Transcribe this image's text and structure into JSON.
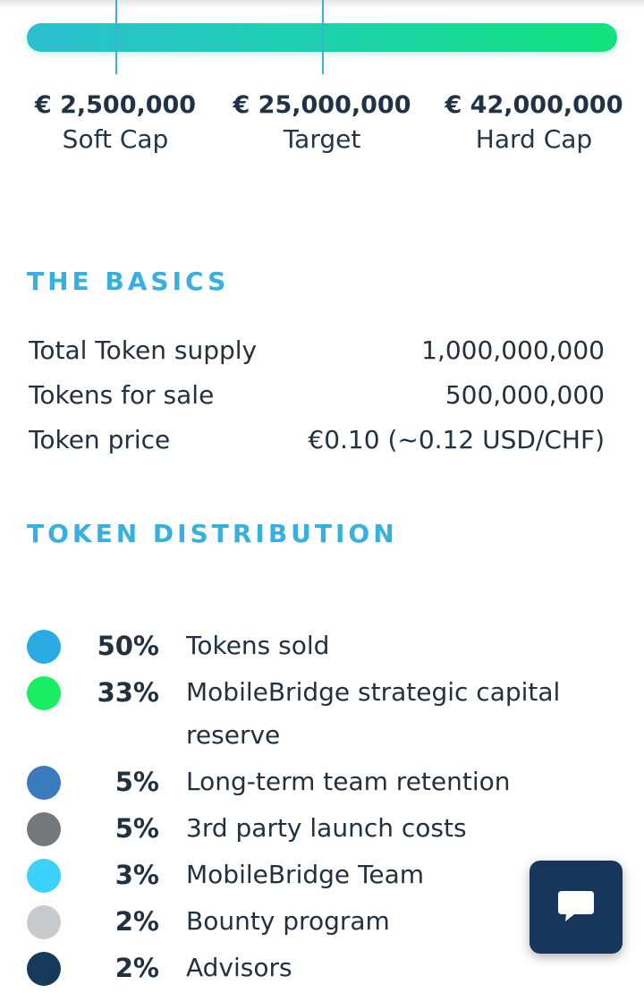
{
  "funding": {
    "soft_cap": {
      "amount": "€ 2,500,000",
      "label": "Soft Cap"
    },
    "target": {
      "amount": "€ 25,000,000",
      "label": "Target"
    },
    "hard_cap": {
      "amount": "€ 42,000,000",
      "label": "Hard Cap"
    },
    "bar_gradient": [
      "#2bbfcf",
      "#12e37e"
    ],
    "marker_color": "#3ab1d6"
  },
  "basics": {
    "heading": "THE BASICS",
    "rows": [
      {
        "label": "Total Token supply",
        "value": "1,000,000,000"
      },
      {
        "label": "Tokens for sale",
        "value": "500,000,000"
      },
      {
        "label": "Token price",
        "value": "€0.10 (~0.12 USD/CHF)"
      }
    ]
  },
  "distribution": {
    "heading": "TOKEN DISTRIBUTION",
    "items": [
      {
        "percent": "50%",
        "label": "Tokens sold",
        "color": "#2aabe4"
      },
      {
        "percent": "33%",
        "label": "MobileBridge strategic capital reserve",
        "color": "#19ee63"
      },
      {
        "percent": "5%",
        "label": "Long-term team retention",
        "color": "#3a7bbd"
      },
      {
        "percent": "5%",
        "label": "3rd party launch costs",
        "color": "#75787b"
      },
      {
        "percent": "3%",
        "label": "MobileBridge Team",
        "color": "#3bd2fb"
      },
      {
        "percent": "2%",
        "label": "Bounty program",
        "color": "#c7cbce"
      },
      {
        "percent": "2%",
        "label": "Advisors",
        "color": "#163a5c"
      }
    ]
  },
  "chat": {
    "icon": "chat-bubble-icon",
    "color": "#16375b"
  }
}
